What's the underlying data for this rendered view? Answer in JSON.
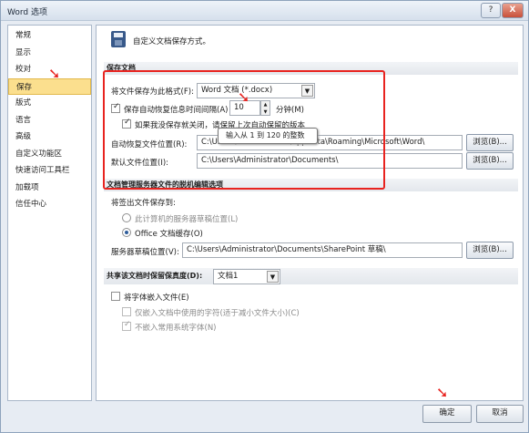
{
  "window": {
    "title": "Word 选项",
    "help_label": "?",
    "close_label": "X"
  },
  "sidebar": {
    "items": [
      {
        "label": "常规"
      },
      {
        "label": "显示"
      },
      {
        "label": "校对"
      },
      {
        "label": "保存"
      },
      {
        "label": "版式"
      },
      {
        "label": "语言"
      },
      {
        "label": "高级"
      },
      {
        "label": "自定义功能区"
      },
      {
        "label": "快速访问工具栏"
      },
      {
        "label": "加载项"
      },
      {
        "label": "信任中心"
      }
    ],
    "active_index": 3
  },
  "header": {
    "text": "自定义文档保存方式。"
  },
  "save_section": {
    "title": "保存文档",
    "format_label": "将文件保存为此格式(F):",
    "format_value": "Word 文档 (*.docx)",
    "autorecover_label": "保存自动恢复信息时间间隔(A)",
    "autorecover_checked": true,
    "autorecover_minutes": "10",
    "minutes_label": "分钟(M)",
    "keep_last_label": "如果我没保存就关闭，请保留上次自动保留的版本",
    "keep_last_checked": true,
    "tooltip": "输入从 1 到 120 的整数",
    "autorecover_location_label": "自动恢复文件位置(R):",
    "autorecover_location_value": "C:\\Users\\Administrator\\AppData\\Roaming\\Microsoft\\Word\\",
    "default_location_label": "默认文件位置(I):",
    "default_location_value": "C:\\Users\\Administrator\\Documents\\",
    "browse_label": "浏览(B)..."
  },
  "offline_section": {
    "title": "文档管理服务器文件的脱机编辑选项",
    "save_to_label": "将签出文件保存到:",
    "option1": "此计算机的服务器草稿位置(L)",
    "option2": "Office 文档缓存(O)",
    "selected": 2,
    "drafts_label": "服务器草稿位置(V):",
    "drafts_value": "C:\\Users\\Administrator\\Documents\\SharePoint 草稿\\",
    "browse_label": "浏览(B)..."
  },
  "fidelity_section": {
    "title": "共享该文档时保留保真度(D):",
    "doc_value": "文档1",
    "embed_fonts_label": "将字体嵌入文件(E)",
    "embed_fonts_checked": false,
    "embed_used_label": "仅嵌入文档中使用的字符(适于减小文件大小)(C)",
    "embed_used_checked": false,
    "no_common_label": "不嵌入常用系统字体(N)",
    "no_common_checked": true
  },
  "footer": {
    "ok_label": "确定",
    "cancel_label": "取消"
  },
  "colors": {
    "annotation_red": "#e8231f",
    "active_item": "#fbdf8e"
  }
}
